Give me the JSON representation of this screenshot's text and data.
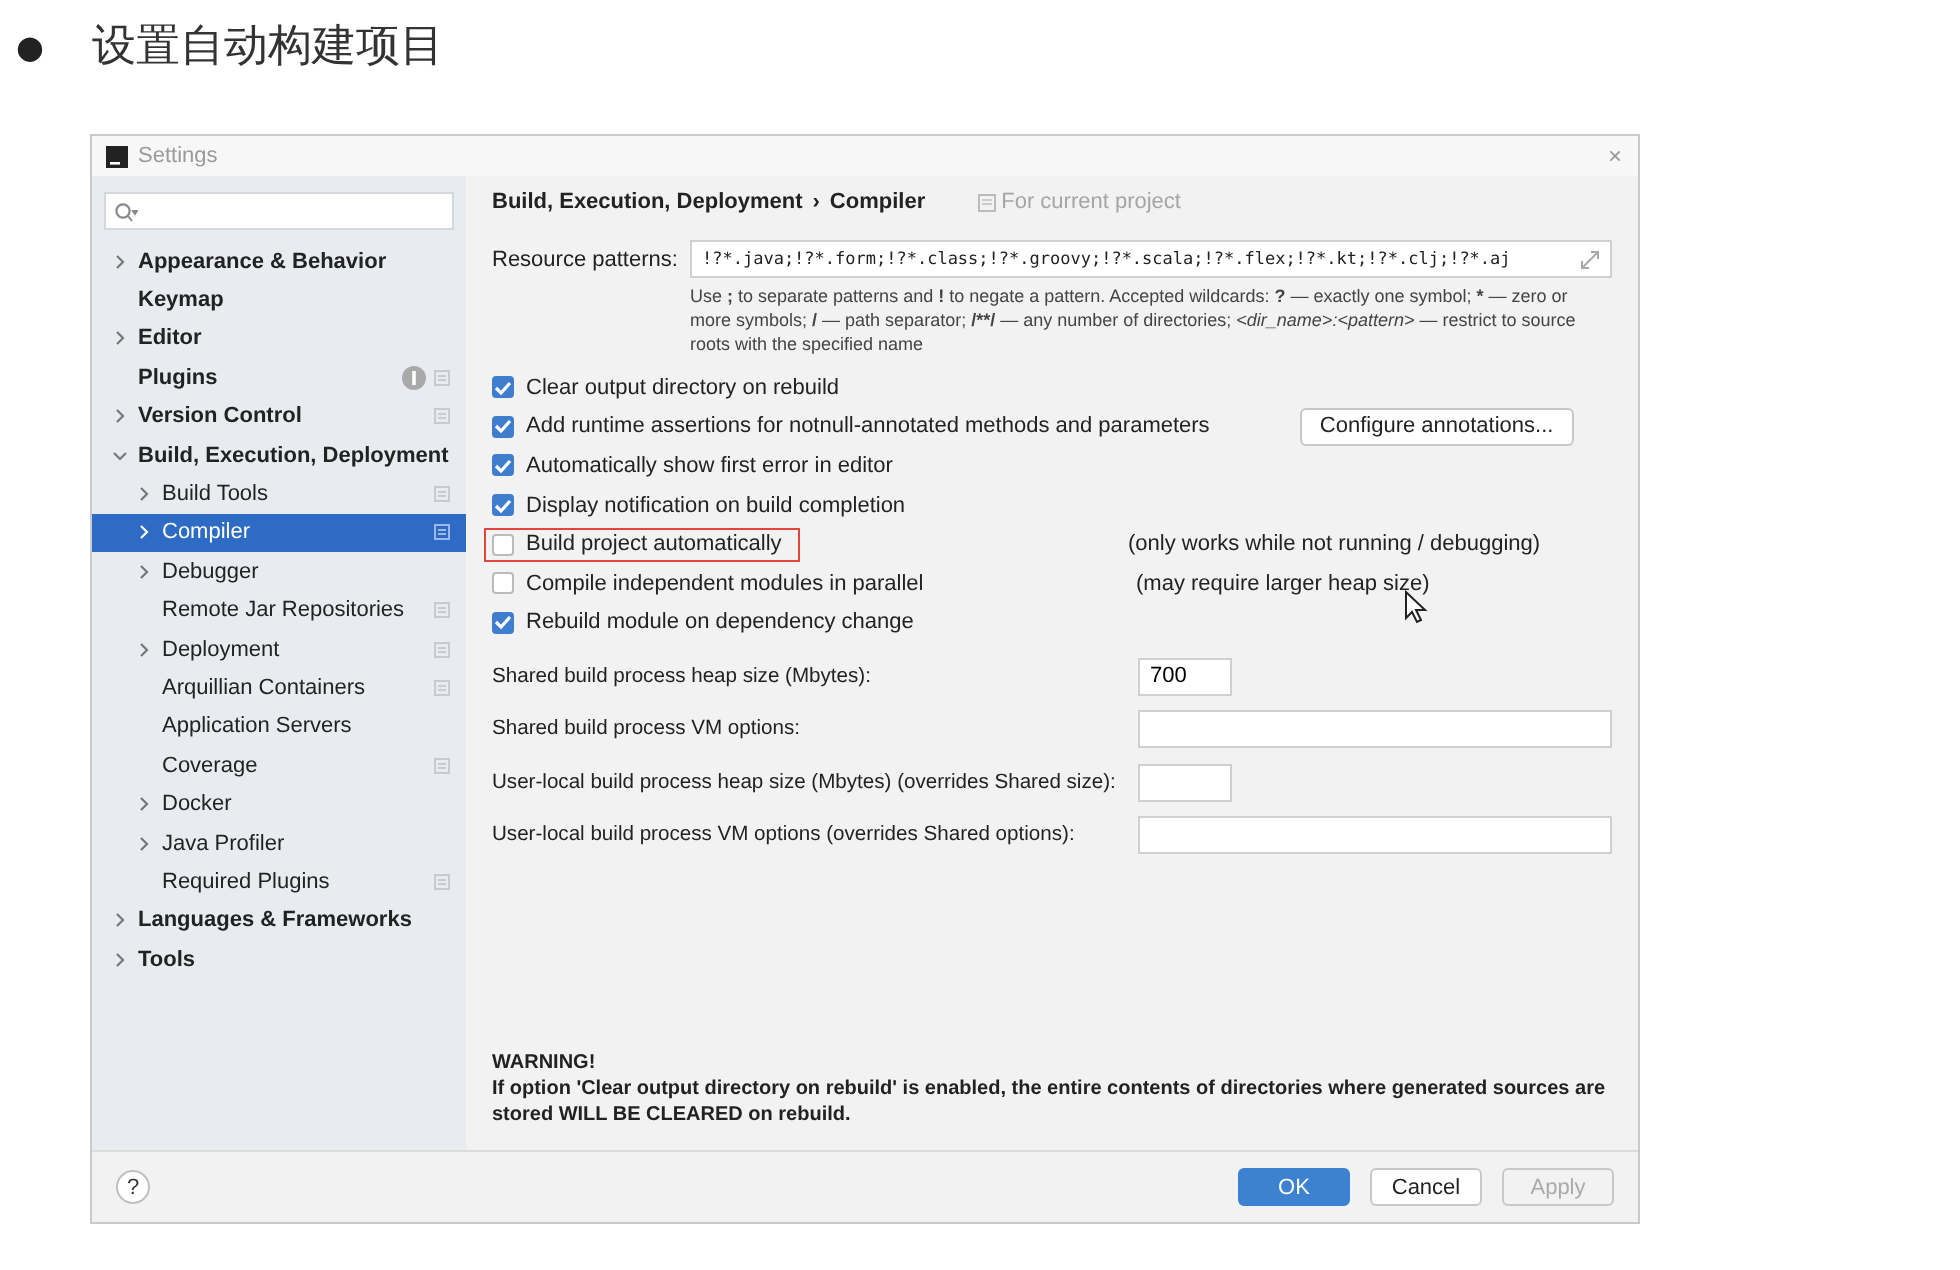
{
  "slide": {
    "bullet": "●",
    "title": "设置自动构建项目"
  },
  "window": {
    "title": "Settings",
    "close": "×"
  },
  "sidebar": {
    "items": [
      {
        "label": "Appearance & Behavior",
        "kind": "folder",
        "expanded": false,
        "selected": false,
        "per_project": false,
        "notification": false
      },
      {
        "label": "Keymap",
        "kind": "leaf",
        "selected": false,
        "per_project": false,
        "notification": false
      },
      {
        "label": "Editor",
        "kind": "folder",
        "expanded": false,
        "selected": false,
        "per_project": false,
        "notification": false
      },
      {
        "label": "Plugins",
        "kind": "leaf",
        "selected": false,
        "per_project": true,
        "notification": true
      },
      {
        "label": "Version Control",
        "kind": "folder",
        "expanded": false,
        "selected": false,
        "per_project": true,
        "notification": false
      },
      {
        "label": "Build, Execution, Deployment",
        "kind": "folder",
        "expanded": true,
        "selected": false,
        "per_project": false,
        "notification": false,
        "children": [
          {
            "label": "Build Tools",
            "kind": "folder",
            "expanded": false,
            "selected": false,
            "per_project": true,
            "notification": false
          },
          {
            "label": "Compiler",
            "kind": "folder",
            "expanded": false,
            "selected": true,
            "per_project": true,
            "notification": false
          },
          {
            "label": "Debugger",
            "kind": "folder",
            "expanded": false,
            "selected": false,
            "per_project": false,
            "notification": false
          },
          {
            "label": "Remote Jar Repositories",
            "kind": "leaf",
            "selected": false,
            "per_project": true,
            "notification": false
          },
          {
            "label": "Deployment",
            "kind": "folder",
            "expanded": false,
            "selected": false,
            "per_project": true,
            "notification": false
          },
          {
            "label": "Arquillian Containers",
            "kind": "leaf",
            "selected": false,
            "per_project": true,
            "notification": false
          },
          {
            "label": "Application Servers",
            "kind": "leaf",
            "selected": false,
            "per_project": false,
            "notification": false
          },
          {
            "label": "Coverage",
            "kind": "leaf",
            "selected": false,
            "per_project": true,
            "notification": false
          },
          {
            "label": "Docker",
            "kind": "folder",
            "expanded": false,
            "selected": false,
            "per_project": false,
            "notification": false
          },
          {
            "label": "Java Profiler",
            "kind": "folder",
            "expanded": false,
            "selected": false,
            "per_project": false,
            "notification": false
          },
          {
            "label": "Required Plugins",
            "kind": "leaf",
            "selected": false,
            "per_project": true,
            "notification": false
          }
        ]
      },
      {
        "label": "Languages & Frameworks",
        "kind": "folder",
        "expanded": false,
        "selected": false,
        "per_project": false,
        "notification": false
      },
      {
        "label": "Tools",
        "kind": "folder",
        "expanded": false,
        "selected": false,
        "per_project": false,
        "notification": false
      }
    ]
  },
  "breadcrumb": {
    "parent": "Build, Execution, Deployment",
    "separator": "›",
    "current": "Compiler",
    "scope": "For current project"
  },
  "resource_patterns": {
    "label": "Resource patterns:",
    "value": "!?*.java;!?*.form;!?*.class;!?*.groovy;!?*.scala;!?*.flex;!?*.kt;!?*.clj;!?*.aj",
    "hint": [
      {
        "text": "Use ",
        "kind": "text"
      },
      {
        "text": ";",
        "kind": "symbol"
      },
      {
        "text": " to separate patterns and ",
        "kind": "text"
      },
      {
        "text": "!",
        "kind": "symbol"
      },
      {
        "text": " to negate a pattern. Accepted wildcards: ",
        "kind": "text"
      },
      {
        "text": "?",
        "kind": "symbol"
      },
      {
        "text": " — exactly one symbol; ",
        "kind": "text"
      },
      {
        "text": "*",
        "kind": "symbol"
      },
      {
        "text": " — zero or more symbols; ",
        "kind": "text"
      },
      {
        "text": "/",
        "kind": "symbol"
      },
      {
        "text": " — path separator; ",
        "kind": "text"
      },
      {
        "text": "/**/",
        "kind": "symbol"
      },
      {
        "text": " — any number of directories; ",
        "kind": "text"
      },
      {
        "text": "<dir_name>:<pattern>",
        "kind": "template"
      },
      {
        "text": " — restrict to source roots with the specified name",
        "kind": "text"
      }
    ]
  },
  "options": [
    {
      "label": "Clear output directory on rebuild",
      "checked": true,
      "highlighted": false
    },
    {
      "label": "Add runtime assertions for notnull-annotated methods and parameters",
      "checked": true,
      "highlighted": false,
      "button": "Configure annotations..."
    },
    {
      "label": "Automatically show first error in editor",
      "checked": true,
      "highlighted": false
    },
    {
      "label": "Display notification on build completion",
      "checked": true,
      "highlighted": false
    },
    {
      "label": "Build project automatically",
      "checked": false,
      "highlighted": true,
      "note": "(only works while not running / debugging)"
    },
    {
      "label": "Compile independent modules in parallel",
      "checked": false,
      "highlighted": false,
      "note": "(may require larger heap size)"
    },
    {
      "label": "Rebuild module on dependency change",
      "checked": true,
      "highlighted": false
    }
  ],
  "fields": [
    {
      "label": "Shared build process heap size (Mbytes):",
      "value": "700",
      "kind": "short"
    },
    {
      "label": "Shared build process VM options:",
      "kind": "long"
    },
    {
      "label": "User-local build process heap size (Mbytes) (overrides Shared size):",
      "kind": "short"
    },
    {
      "label": "User-local build process VM options (overrides Shared options):",
      "kind": "long"
    }
  ],
  "warning": {
    "title": "WARNING!",
    "text": "If option 'Clear output directory on rebuild' is enabled, the entire contents of directories where generated sources are stored WILL BE CLEARED on rebuild."
  },
  "footer": {
    "help": "?",
    "buttons": [
      {
        "label": "OK",
        "kind": "primary",
        "disabled": false
      },
      {
        "label": "Cancel",
        "kind": "normal",
        "disabled": false
      },
      {
        "label": "Apply",
        "kind": "normal",
        "disabled": true
      }
    ]
  }
}
